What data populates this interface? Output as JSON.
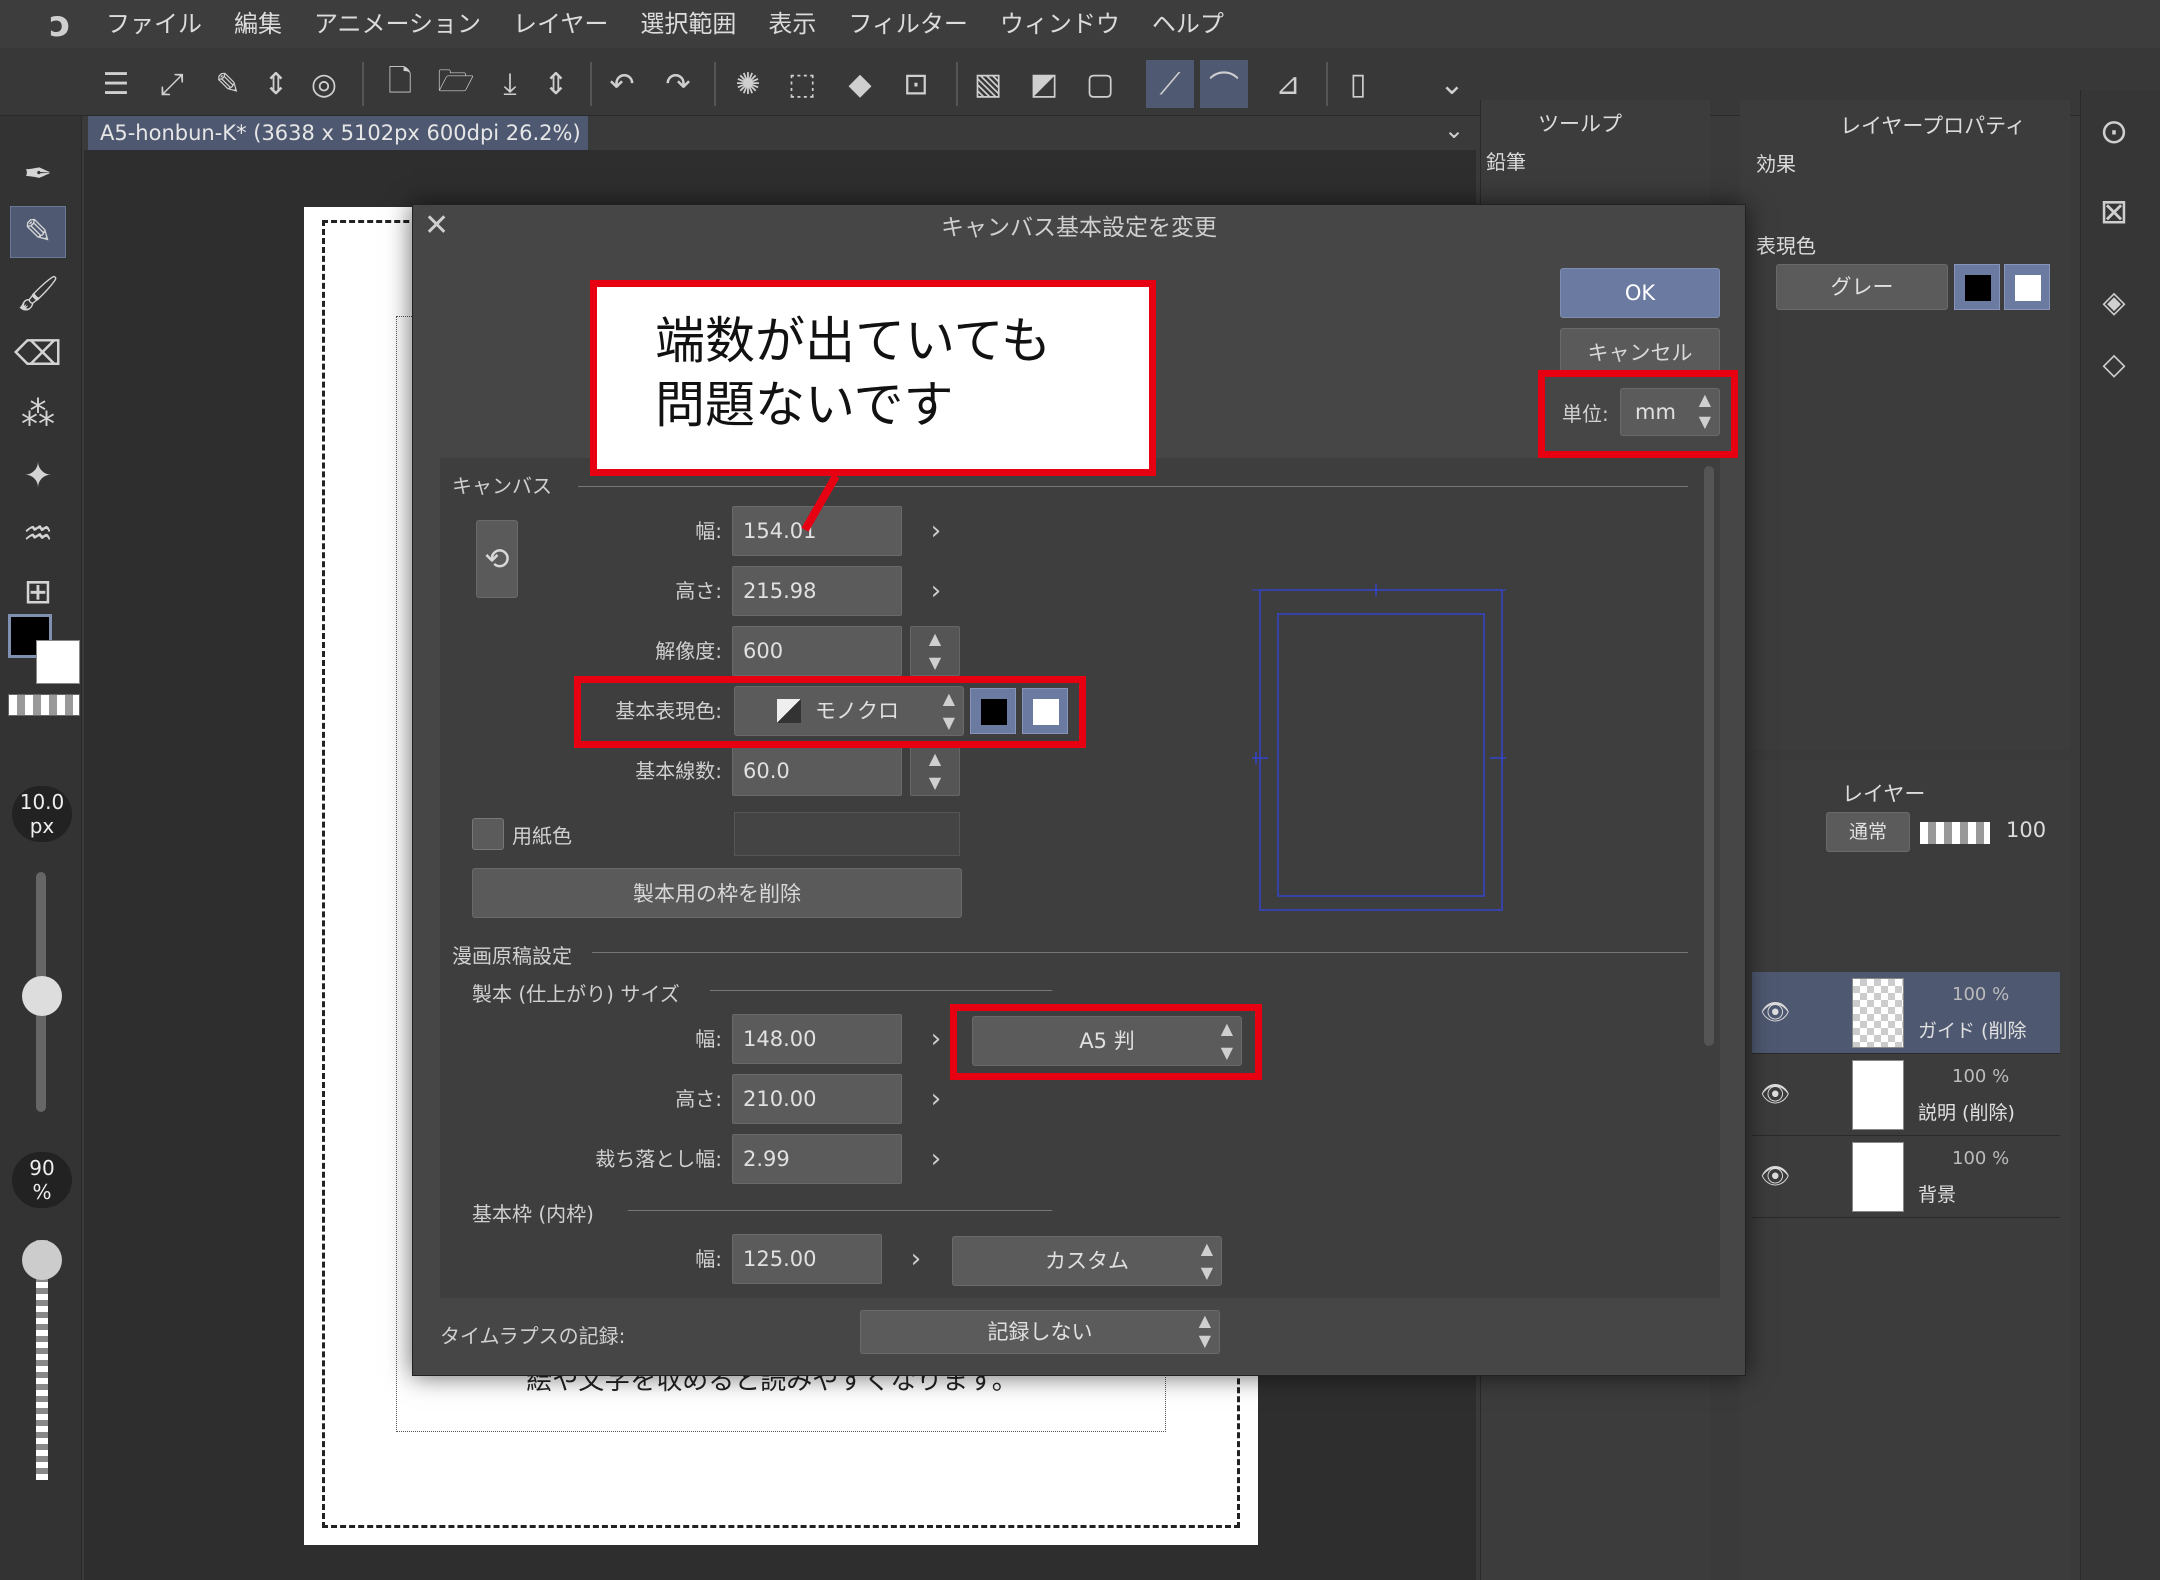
{
  "menu": [
    "ファイル",
    "編集",
    "アニメーション",
    "レイヤー",
    "選択範囲",
    "表示",
    "フィルター",
    "ウィンドウ",
    "ヘルプ"
  ],
  "canvas_tab": "A5-honbun-K* (3638 x 5102px 600dpi 26.2%)",
  "left_tools": {
    "brush_size": "10.0",
    "brush_unit": "px",
    "opacity_value": "90",
    "opacity_unit": "%"
  },
  "tool_panel": {
    "tab": "ツールプ",
    "sub_tool": "鉛筆"
  },
  "layer_property": {
    "tab": "レイヤープロパティ",
    "effect_label": "効果",
    "color_label": "表現色",
    "color_value": "グレー"
  },
  "layer_panel": {
    "tab": "レイヤー",
    "blend_mode": "通常",
    "opacity": "100",
    "layers": [
      {
        "name": "ガイド (削除",
        "opacity": "100 %"
      },
      {
        "name": "説明 (削除)",
        "opacity": "100 %"
      },
      {
        "name": "背景",
        "opacity": "100 %"
      }
    ]
  },
  "paper_note": "絵や文字を収めると読みやすくなります。",
  "dialog": {
    "title": "キャンバス基本設定を変更",
    "ok": "OK",
    "cancel": "キャンセル",
    "unit_label": "単位:",
    "unit_value": "mm",
    "canvas_section": "キャンバス",
    "width_label": "幅:",
    "width_value": "154.01",
    "height_label": "高さ:",
    "height_value": "215.98",
    "resolution_label": "解像度:",
    "resolution_value": "600",
    "color_mode_label": "基本表現色:",
    "color_mode_value": "モノクロ",
    "lines_label": "基本線数:",
    "lines_value": "60.0",
    "paper_color_label": "用紙色",
    "remove_frame_button": "製本用の枠を削除",
    "manga_section": "漫画原稿設定",
    "trim_section": "製本 (仕上がり) サイズ",
    "trim_width_label": "幅:",
    "trim_width_value": "148.00",
    "trim_preset": "A5 判",
    "trim_height_label": "高さ:",
    "trim_height_value": "210.00",
    "bleed_label": "裁ち落とし幅:",
    "bleed_value": "2.99",
    "inner_frame_section": "基本枠 (内枠)",
    "inner_width_label": "幅:",
    "inner_width_value": "125.00",
    "inner_preset": "カスタム",
    "timelapse_label": "タイムラプスの記録:",
    "timelapse_value": "記録しない"
  },
  "callout": {
    "line1": "端数が出ていても",
    "line2": "問題ないです"
  },
  "colors": {
    "accent": "#6b7aa0",
    "highlight": "#e60012",
    "panel": "#3c3c3c"
  }
}
